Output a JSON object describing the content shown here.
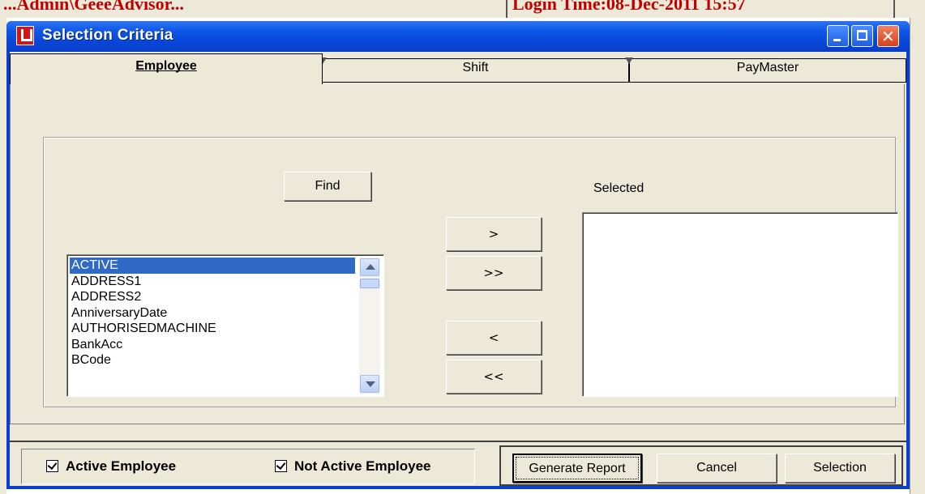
{
  "background": {
    "left_text": "...Admin\\GeeeAdvisor...",
    "right_text": "Login Time:08-Dec-2011 15:57"
  },
  "window": {
    "title": "Selection Criteria"
  },
  "tabs": [
    {
      "label": "Employee",
      "mnemonic": "E",
      "active": true
    },
    {
      "label": "Shift",
      "mnemonic": "S",
      "active": false
    },
    {
      "label": "PayMaster",
      "mnemonic": "P",
      "active": false
    }
  ],
  "employee_tab": {
    "find_label": "Find",
    "selected_label": "Selected",
    "move_buttons": {
      "add": ">",
      "add_all": ">>",
      "remove": "<",
      "remove_all": "<<"
    },
    "available_fields": [
      "ACTIVE",
      "ADDRESS1",
      "ADDRESS2",
      "AnniversaryDate",
      "AUTHORISEDMACHINE",
      "BankAcc",
      "BCode"
    ],
    "selected_index": 0,
    "selected_fields": []
  },
  "footer": {
    "active_employee": {
      "label": "Active Employee",
      "checked": true
    },
    "not_active_employee": {
      "label": "Not Active Employee",
      "checked": true
    },
    "generate_report": "Generate Report",
    "cancel": "Cancel",
    "selection": "Selection"
  }
}
